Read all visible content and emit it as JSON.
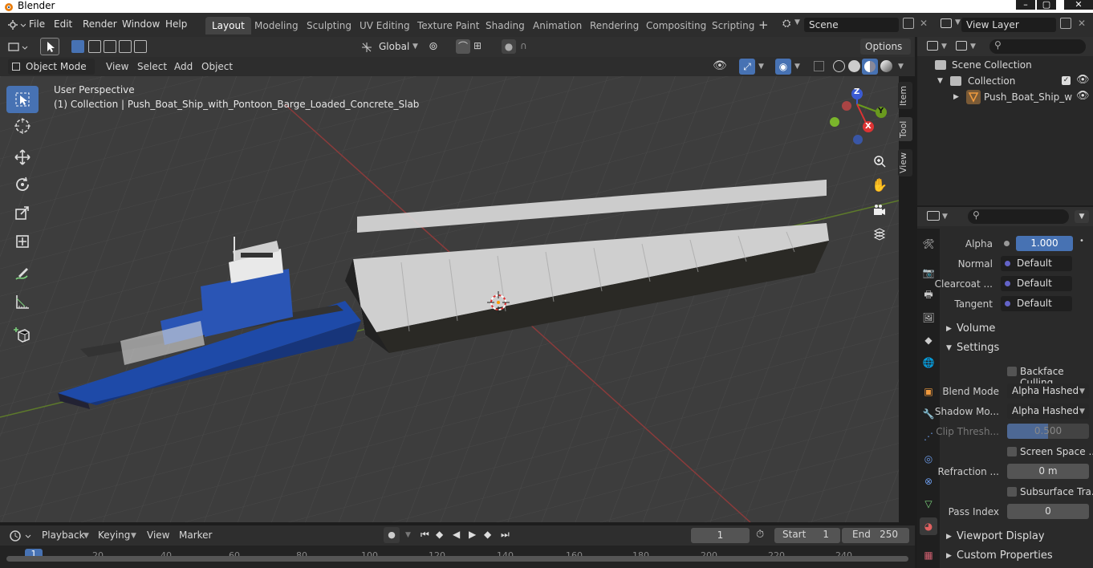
{
  "window": {
    "title": "Blender"
  },
  "menubar": {
    "items": [
      "File",
      "Edit",
      "Render",
      "Window",
      "Help"
    ]
  },
  "workspaces": [
    "Layout",
    "Modeling",
    "Sculpting",
    "UV Editing",
    "Texture Paint",
    "Shading",
    "Animation",
    "Rendering",
    "Compositing",
    "Scripting"
  ],
  "active_workspace": "Layout",
  "scene": {
    "name": "Scene",
    "view_layer": "View Layer"
  },
  "viewport_header": {
    "transform_orientation": "Global",
    "options_label": "Options",
    "mode": "Object Mode",
    "menus": [
      "View",
      "Select",
      "Add",
      "Object"
    ]
  },
  "viewport": {
    "perspective": "User Perspective",
    "object_info": "(1) Collection | Push_Boat_Ship_with_Pontoon_Barge_Loaded_Concrete_Slab",
    "side_tabs": [
      "Item",
      "Tool",
      "View"
    ],
    "gizmo_axes": {
      "z": "Z",
      "y": "Y",
      "x": "X"
    }
  },
  "outliner": {
    "scene_collection": "Scene Collection",
    "collection": "Collection",
    "object": "Push_Boat_Ship_w"
  },
  "properties": {
    "alpha_label": "Alpha",
    "alpha_value": "1.000",
    "normal_label": "Normal",
    "normal_value": "Default",
    "clearcoat_label": "Clearcoat ...",
    "clearcoat_value": "Default",
    "tangent_label": "Tangent",
    "tangent_value": "Default",
    "volume_section": "Volume",
    "settings_section": "Settings",
    "backface_culling": "Backface Culling",
    "blend_mode_label": "Blend Mode",
    "blend_mode_value": "Alpha Hashed",
    "shadow_mode_label": "Shadow Mo...",
    "shadow_mode_value": "Alpha Hashed",
    "clip_threshold_label": "Clip Thresh...",
    "clip_threshold_value": "0.500",
    "screen_space_label": "Screen Space ...",
    "refraction_label": "Refraction ...",
    "refraction_value": "0 m",
    "subsurface_label": "Subsurface Tra...",
    "pass_index_label": "Pass Index",
    "pass_index_value": "0",
    "viewport_display_section": "Viewport Display",
    "custom_properties_section": "Custom Properties"
  },
  "timeline": {
    "menus": [
      "Playback",
      "Keying",
      "View",
      "Marker"
    ],
    "current_frame": "1",
    "start_label": "Start",
    "start_value": "1",
    "end_label": "End",
    "end_value": "250",
    "ruler": [
      "1",
      "20",
      "40",
      "60",
      "80",
      "100",
      "120",
      "140",
      "160",
      "180",
      "200",
      "220",
      "240"
    ]
  },
  "colors": {
    "accent": "#4772b3",
    "hull_blue": "#1e4aa8",
    "barge_dark": "#2a2925"
  }
}
